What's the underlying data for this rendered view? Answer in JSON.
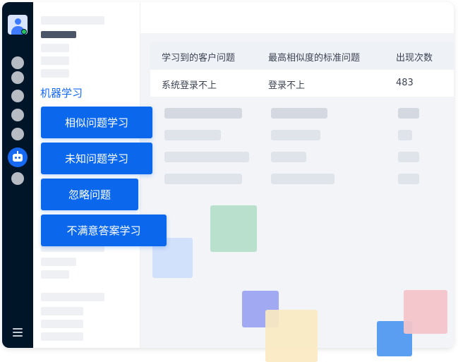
{
  "sidebar": {
    "title": "机器学习"
  },
  "menu": {
    "items": [
      {
        "label": "相似问题学习"
      },
      {
        "label": "未知问题学习"
      },
      {
        "label": "忽略问题"
      },
      {
        "label": "不满意答案学习"
      }
    ]
  },
  "table": {
    "columns": [
      "学习到的客户问题",
      "最高相似度的标准问题",
      "出现次数"
    ],
    "rows": [
      [
        "系统登录不上",
        "登录不上",
        "483"
      ]
    ]
  },
  "colors": {
    "rail": "#001528",
    "accent": "#0b68ed",
    "online": "#22c55e"
  },
  "icons": [
    "user-avatar-icon",
    "robot-icon",
    "hamburger-menu-icon"
  ]
}
